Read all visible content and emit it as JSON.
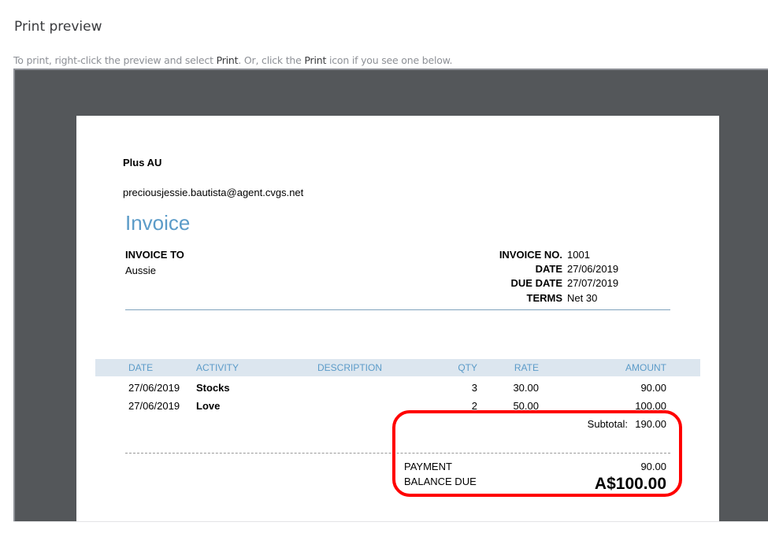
{
  "page": {
    "title": "Print preview",
    "hint_parts": [
      "To print, right-click the preview and select ",
      "Print",
      ". Or, click the ",
      "Print",
      " icon if you see one below."
    ]
  },
  "invoice": {
    "company": "Plus AU",
    "email": "preciousjessie.bautista@agent.cvgs.net",
    "heading": "Invoice",
    "to_label": "INVOICE TO",
    "to_value": "Aussie",
    "meta": [
      {
        "label": "INVOICE NO.",
        "value": "1001"
      },
      {
        "label": "DATE",
        "value": "27/06/2019"
      },
      {
        "label": "DUE DATE",
        "value": "27/07/2019"
      },
      {
        "label": "TERMS",
        "value": "Net 30"
      }
    ],
    "columns": [
      "DATE",
      "ACTIVITY",
      "DESCRIPTION",
      "QTY",
      "RATE",
      "AMOUNT"
    ],
    "rows": [
      {
        "date": "27/06/2019",
        "activity": "Stocks",
        "description": "",
        "qty": "3",
        "rate": "30.00",
        "amount": "90.00"
      },
      {
        "date": "27/06/2019",
        "activity": "Love",
        "description": "",
        "qty": "2",
        "rate": "50.00",
        "amount": "100.00"
      }
    ],
    "subtotal_label": "Subtotal:",
    "subtotal": "190.00",
    "payment_label": "PAYMENT",
    "payment": "90.00",
    "balance_label": "BALANCE DUE",
    "balance": "A$100.00"
  },
  "colors": {
    "frame": "#54575a",
    "accent": "#5b9bc8",
    "highlight": "#ff0000"
  }
}
